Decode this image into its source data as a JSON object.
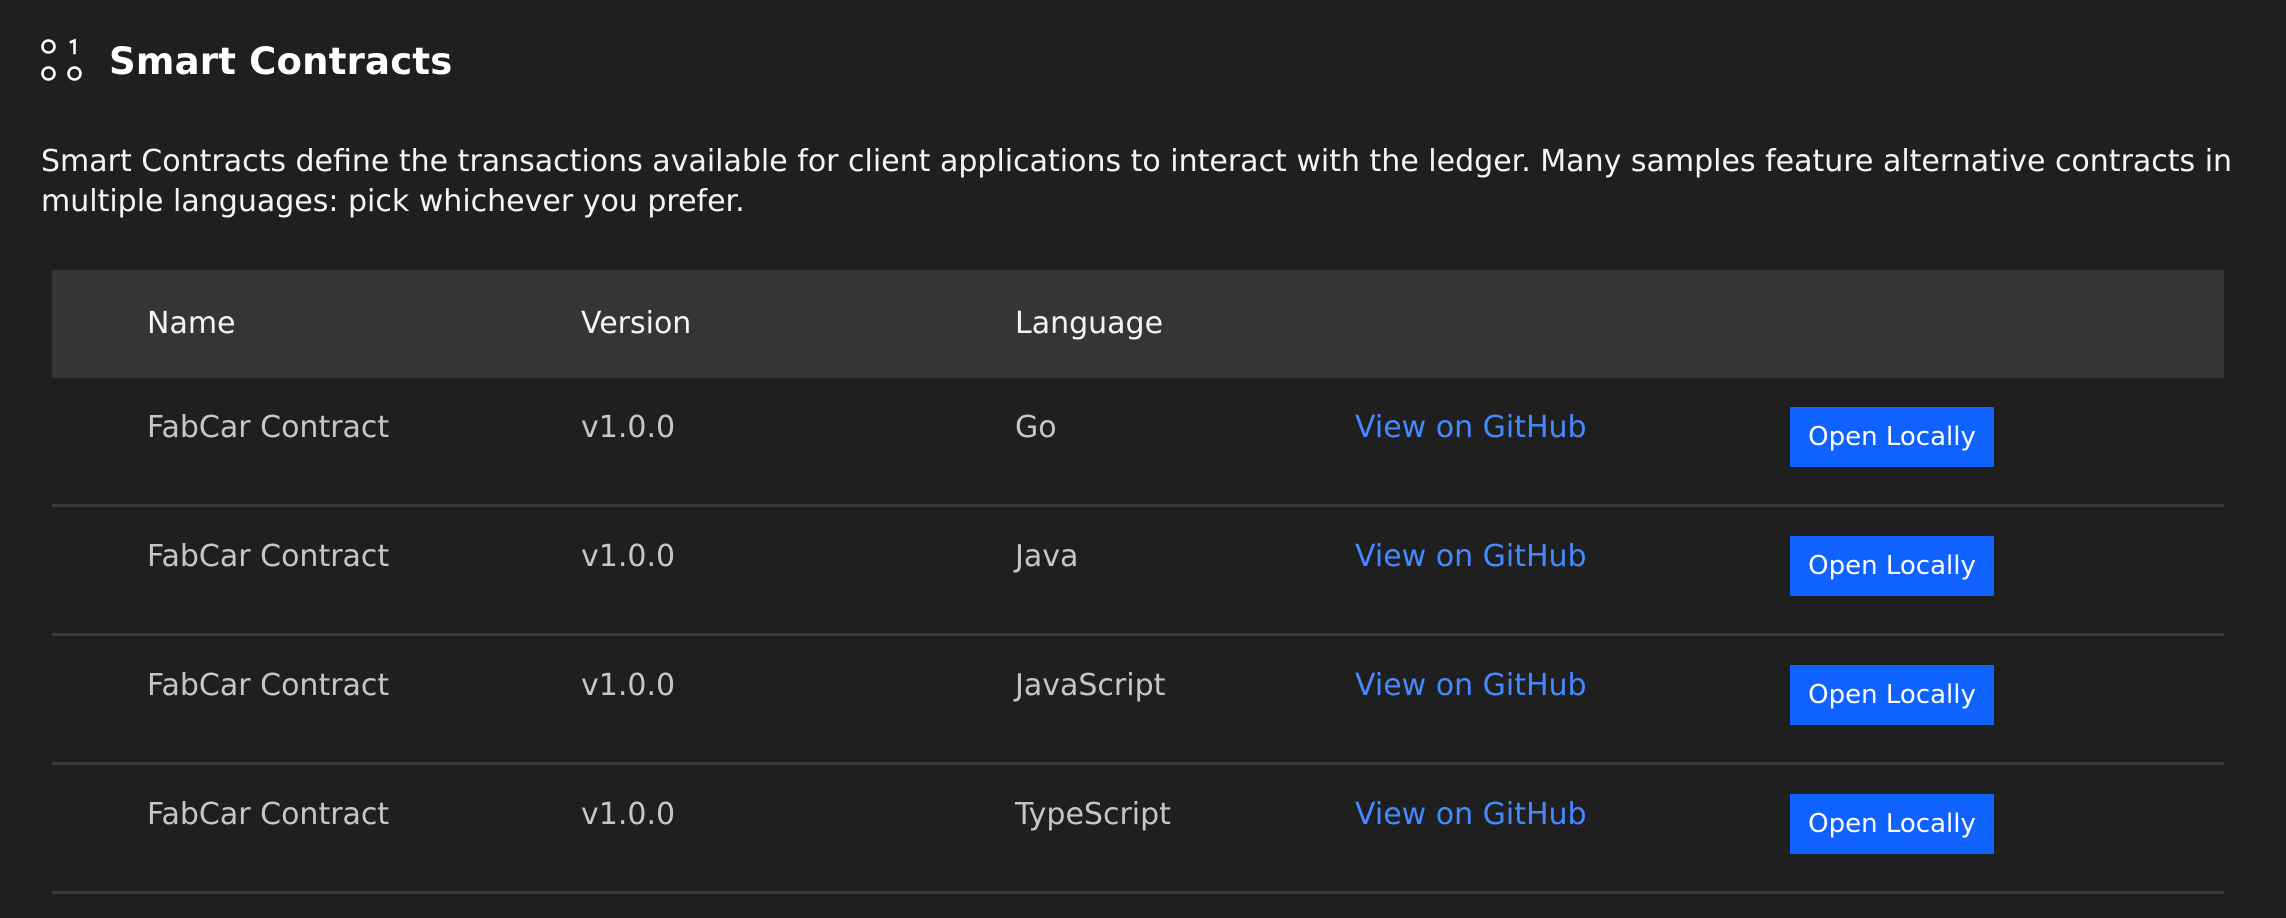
{
  "section": {
    "icon": "smart-contract-icon",
    "title": "Smart Contracts",
    "description": "Smart Contracts define the transactions available for client applications to interact with the ledger. Many samples feature alternative contracts in multiple languages: pick whichever you prefer."
  },
  "table": {
    "headers": {
      "name": "Name",
      "version": "Version",
      "language": "Language"
    },
    "rows": [
      {
        "name": "FabCar Contract",
        "version": "v1.0.0",
        "language": "Go",
        "github_label": "View on GitHub",
        "open_label": "Open Locally"
      },
      {
        "name": "FabCar Contract",
        "version": "v1.0.0",
        "language": "Java",
        "github_label": "View on GitHub",
        "open_label": "Open Locally"
      },
      {
        "name": "FabCar Contract",
        "version": "v1.0.0",
        "language": "JavaScript",
        "github_label": "View on GitHub",
        "open_label": "Open Locally"
      },
      {
        "name": "FabCar Contract",
        "version": "v1.0.0",
        "language": "TypeScript",
        "github_label": "View on GitHub",
        "open_label": "Open Locally"
      }
    ]
  },
  "colors": {
    "background": "#1f1f1f",
    "header_row": "#353535",
    "link": "#4589ff",
    "primary_button": "#0f62fe"
  }
}
